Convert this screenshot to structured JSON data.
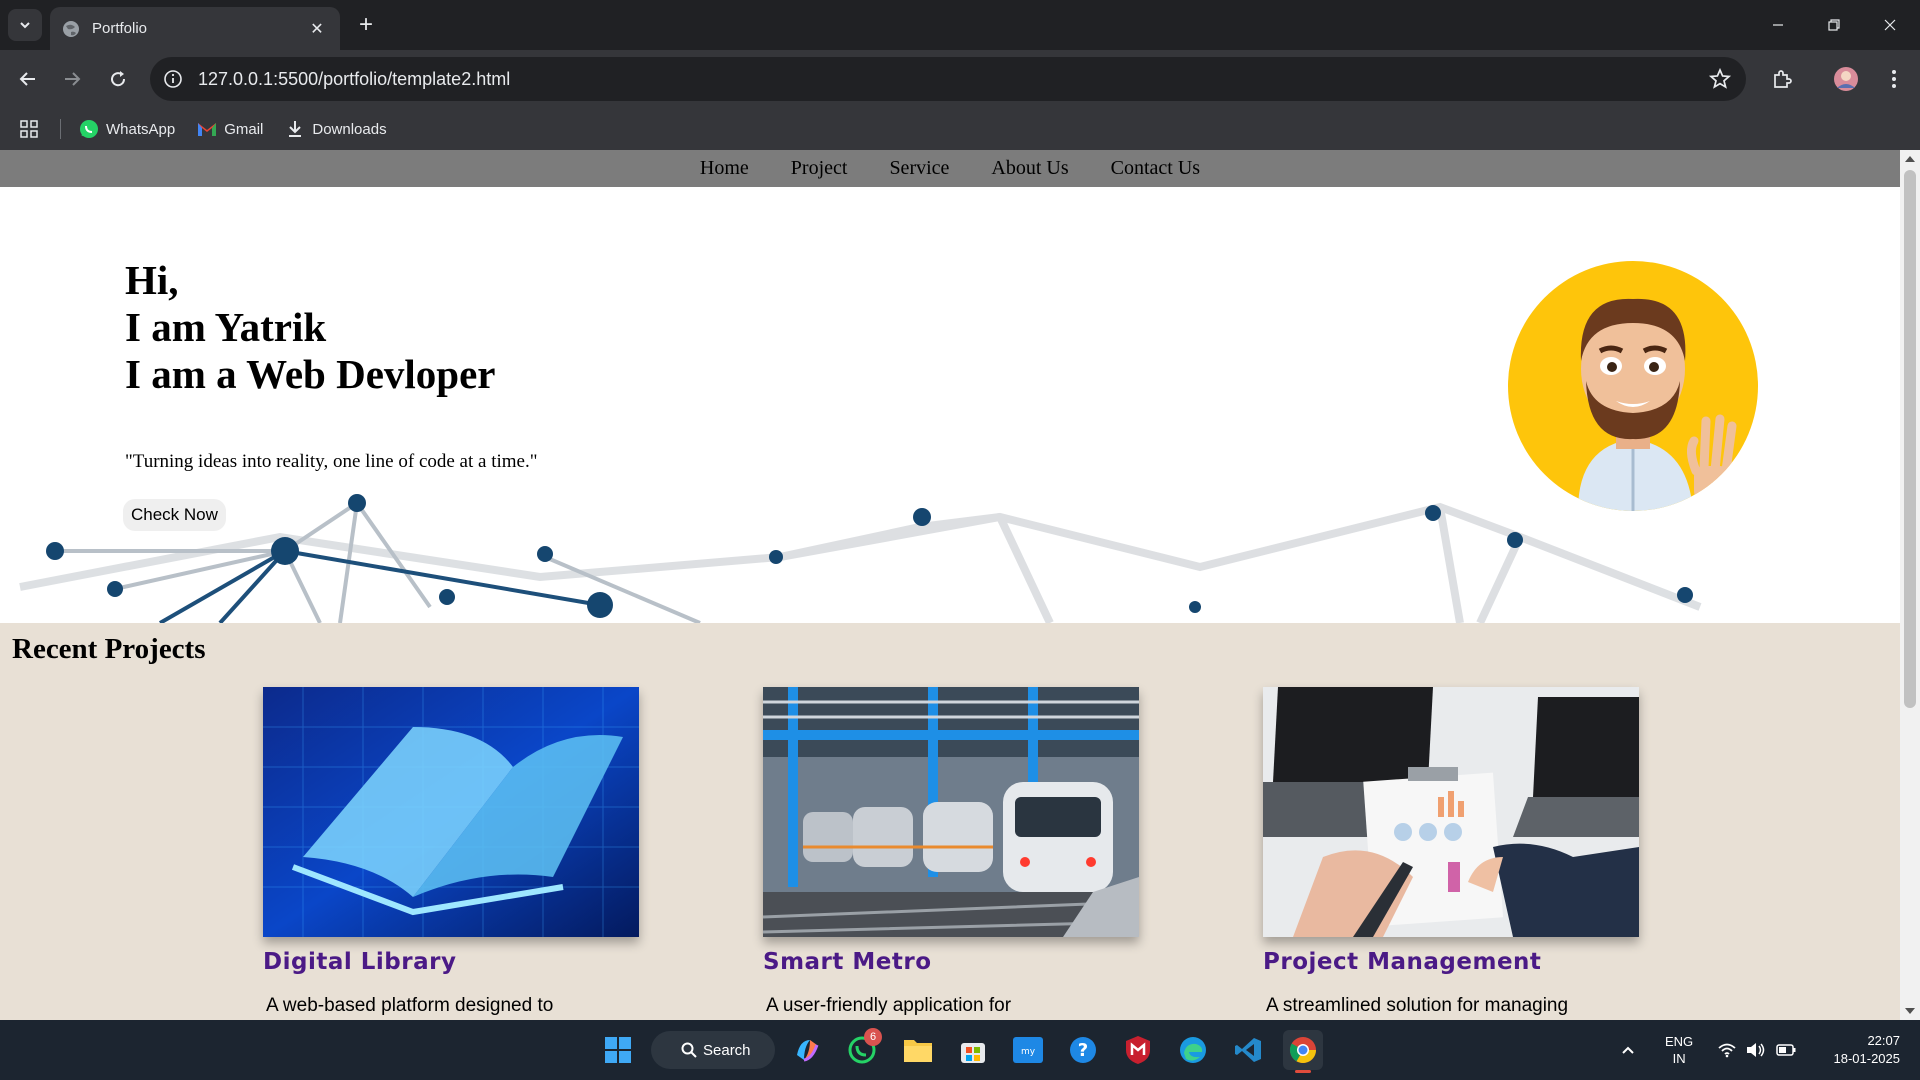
{
  "browser": {
    "tab_title": "Portfolio",
    "url": "127.0.0.1:5500/portfolio/template2.html",
    "bookmarks": [
      {
        "label": "WhatsApp",
        "icon": "whatsapp-icon"
      },
      {
        "label": "Gmail",
        "icon": "gmail-icon"
      },
      {
        "label": "Downloads",
        "icon": "download-icon"
      }
    ]
  },
  "site": {
    "nav": [
      "Home",
      "Project",
      "Service",
      "About Us",
      "Contact Us"
    ],
    "hero": {
      "line1": "Hi,",
      "line2": "I am Yatrik",
      "line3": "I am a Web Devloper",
      "quote": "\"Turning ideas into reality, one line of code at a time.\"",
      "button": "Check Now"
    },
    "projects": {
      "heading": "Recent Projects",
      "items": [
        {
          "title": "Digital Library",
          "desc": "A web-based platform designed to"
        },
        {
          "title": "Smart Metro",
          "desc": "A user-friendly application for"
        },
        {
          "title": "Project Management",
          "desc": "A streamlined solution for managing"
        }
      ]
    }
  },
  "taskbar": {
    "search_label": "Search",
    "whatsapp_badge": "6",
    "lang_top": "ENG",
    "lang_bottom": "IN",
    "time": "22:07",
    "date": "18-01-2025"
  },
  "colors": {
    "nav_bg": "#7c7c7c",
    "projects_bg": "#e8e0d5",
    "project_title": "#4b1a86",
    "avatar_bg": "#fec50b"
  }
}
